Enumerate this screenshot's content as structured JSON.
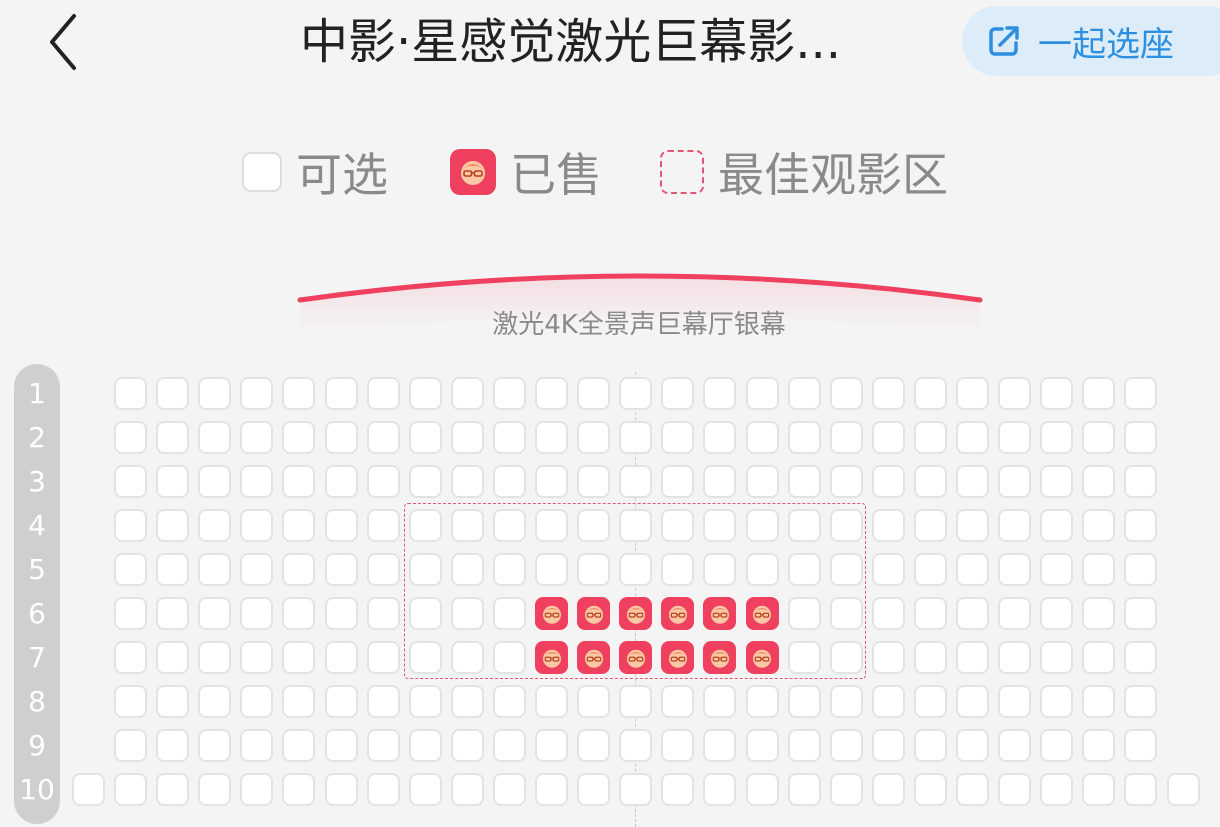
{
  "header": {
    "title": "中影·星感觉激光巨幕影...",
    "together_label": "一起选座",
    "back_icon": "chevron-left-icon",
    "together_icon": "share-icon"
  },
  "legend": {
    "available_label": "可选",
    "sold_label": "已售",
    "best_label": "最佳观影区"
  },
  "screen": {
    "label": "激光4K全景声巨幕厅银幕",
    "color": "#f0405f"
  },
  "rows": [
    "1",
    "2",
    "3",
    "4",
    "5",
    "6",
    "7",
    "8",
    "9",
    "10"
  ],
  "sold_seats": [
    {
      "row": 6,
      "seats": [
        11,
        12,
        13,
        14,
        15,
        16
      ]
    },
    {
      "row": 7,
      "seats": [
        11,
        12,
        13,
        14,
        15,
        16
      ]
    }
  ],
  "colors": {
    "accent": "#f0405f",
    "link": "#2d8fe0"
  }
}
